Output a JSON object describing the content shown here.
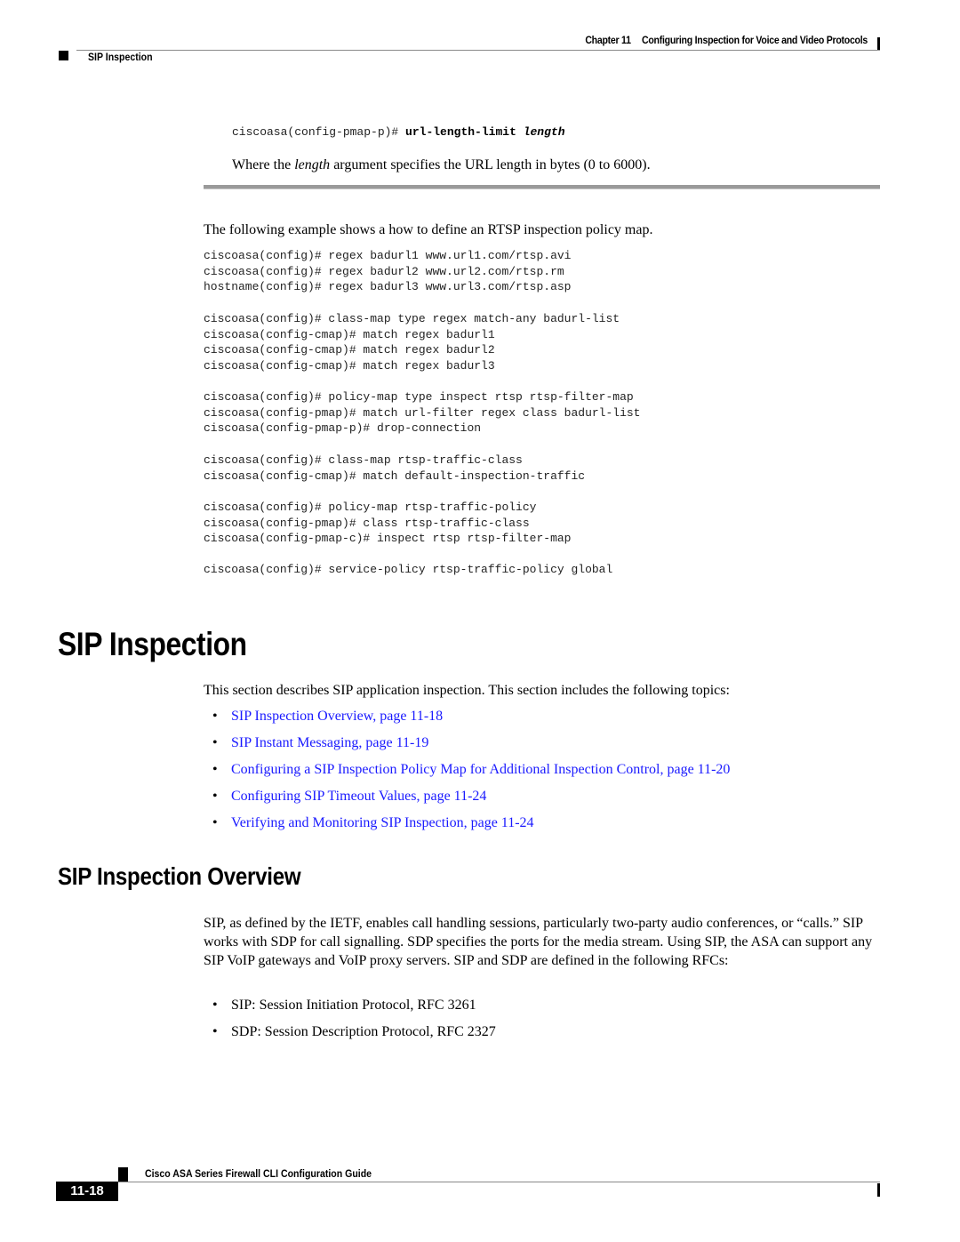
{
  "header": {
    "chapter_label": "Chapter 11",
    "chapter_title": "Configuring Inspection for Voice and Video Protocols",
    "section": "SIP Inspection"
  },
  "top_command": {
    "prompt": "ciscoasa(config-pmap-p)# ",
    "command": "url-length-limit",
    "argument": "length"
  },
  "where_text": {
    "before": "Where the ",
    "arg": "length",
    "after": " argument specifies the URL length in bytes (0 to 6000)."
  },
  "example_intro": "The following example shows a how to define an RTSP inspection policy map.",
  "code_blocks": [
    [
      "ciscoasa(config)# regex badurl1 www.url1.com/rtsp.avi",
      "ciscoasa(config)# regex badurl2 www.url2.com/rtsp.rm",
      "hostname(config)# regex badurl3 www.url3.com/rtsp.asp"
    ],
    [
      "ciscoasa(config)# class-map type regex match-any badurl-list",
      "ciscoasa(config-cmap)# match regex badurl1",
      "ciscoasa(config-cmap)# match regex badurl2",
      "ciscoasa(config-cmap)# match regex badurl3"
    ],
    [
      "ciscoasa(config)# policy-map type inspect rtsp rtsp-filter-map",
      "ciscoasa(config-pmap)# match url-filter regex class badurl-list",
      "ciscoasa(config-pmap-p)# drop-connection"
    ],
    [
      "ciscoasa(config)# class-map rtsp-traffic-class",
      "ciscoasa(config-cmap)# match default-inspection-traffic"
    ],
    [
      "ciscoasa(config)# policy-map rtsp-traffic-policy",
      "ciscoasa(config-pmap)# class rtsp-traffic-class",
      "ciscoasa(config-pmap-c)# inspect rtsp rtsp-filter-map"
    ],
    [
      "ciscoasa(config)# service-policy rtsp-traffic-policy global"
    ]
  ],
  "section_heading": "SIP Inspection",
  "section_intro": "This section describes SIP application inspection. This section includes the following topics:",
  "topics": [
    {
      "label": "SIP Inspection Overview, page 11-18"
    },
    {
      "label": "SIP Instant Messaging, page 11-19"
    },
    {
      "label": "Configuring a SIP Inspection Policy Map for Additional Inspection Control, page 11-20"
    },
    {
      "label": "Configuring SIP Timeout Values, page 11-24"
    },
    {
      "label": "Verifying and Monitoring SIP Inspection, page 11-24"
    }
  ],
  "bullet_glyph": "•",
  "subsection_heading": "SIP Inspection Overview",
  "overview_paragraph": "SIP, as defined by the IETF, enables call handling sessions, particularly two-party audio conferences, or “calls.” SIP works with SDP for call signalling. SDP specifies the ports for the media stream. Using SIP, the ASA can support any SIP VoIP gateways and VoIP proxy servers. SIP and SDP are defined in the following RFCs:",
  "rfcs": [
    {
      "label": "SIP: Session Initiation Protocol, RFC 3261"
    },
    {
      "label": "SDP: Session Description Protocol, RFC 2327"
    }
  ],
  "footer": {
    "guide_title": "Cisco ASA Series Firewall CLI Configuration Guide",
    "page_number": "11-18"
  },
  "colors": {
    "link": "#1a1aff",
    "rule": "#8a8a8a"
  }
}
